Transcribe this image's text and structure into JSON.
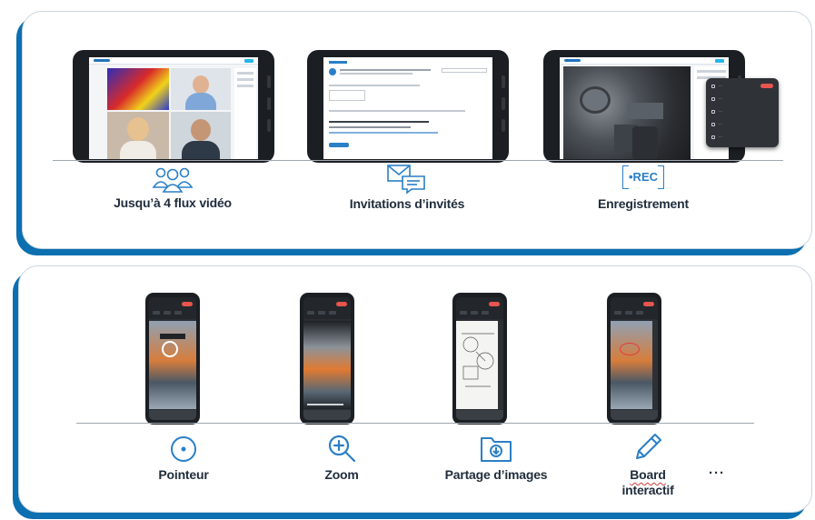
{
  "top_features": [
    {
      "label": "Jusqu’à 4 flux vidéo",
      "icon": "group-users-icon"
    },
    {
      "label": "Invitations d’invités",
      "icon": "envelope-chat-icon"
    },
    {
      "label": "Enregistrement",
      "icon": "rec-icon"
    }
  ],
  "rec_badge": "•REC",
  "bottom_features": [
    {
      "label": "Pointeur",
      "icon": "pointer-target-icon"
    },
    {
      "label": "Zoom",
      "icon": "zoom-in-icon"
    },
    {
      "label": "Partage d’images",
      "icon": "image-share-icon"
    },
    {
      "label_line1": "Board",
      "label_line2": "interactif",
      "icon": "pencil-icon"
    }
  ],
  "more_label": "···",
  "colors": {
    "accent": "#0b6fb0",
    "icon_blue": "#2a7fc6",
    "text_dark": "#1f2c3b",
    "rec_red": "#e8554e"
  }
}
